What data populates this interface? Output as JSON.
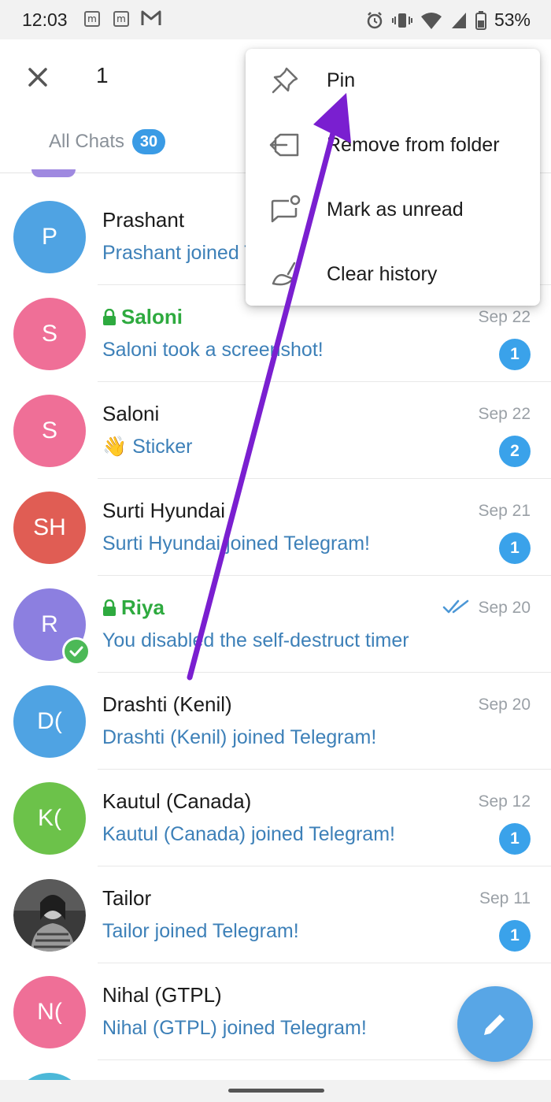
{
  "status_bar": {
    "time": "12:03",
    "notification_icons": [
      "m",
      "m"
    ],
    "battery_percent": "53%"
  },
  "action_bar": {
    "selected_count": "1",
    "tab": {
      "label": "All Chats",
      "badge": "30"
    }
  },
  "context_menu": {
    "items": [
      {
        "label": "Pin",
        "icon": "pin-icon"
      },
      {
        "label": "Remove from folder",
        "icon": "folder-remove-icon"
      },
      {
        "label": "Mark as unread",
        "icon": "mark-unread-icon"
      },
      {
        "label": "Clear history",
        "icon": "clear-history-icon"
      }
    ]
  },
  "chats": [
    {
      "initials": "P",
      "name": "Prashant",
      "message": "Prashant joined Telegram!",
      "date": "",
      "unread": "",
      "secret": false,
      "color": "#4fa3e3"
    },
    {
      "initials": "S",
      "name": "Saloni",
      "message": "Saloni took a screenshot!",
      "date": "Sep 22",
      "unread": "1",
      "secret": true,
      "color": "#ef6f97"
    },
    {
      "initials": "S",
      "name": "Saloni",
      "message": "👋 Sticker",
      "date": "Sep 22",
      "unread": "2",
      "secret": false,
      "color": "#ef6f97"
    },
    {
      "initials": "SH",
      "name": "Surti Hyundai",
      "message": "Surti Hyundai joined Telegram!",
      "date": "Sep 21",
      "unread": "1",
      "secret": false,
      "color": "#e05d54"
    },
    {
      "initials": "R",
      "name": "Riya",
      "message": "You disabled the self-destruct timer",
      "date": "Sep 20",
      "unread": "",
      "secret": true,
      "color": "#8c7fe0",
      "read_ticks": true,
      "online_check": true
    },
    {
      "initials": "D(",
      "name": "Drashti (Kenil)",
      "message": "Drashti (Kenil) joined Telegram!",
      "date": "Sep 20",
      "unread": "",
      "secret": false,
      "color": "#4fa3e3"
    },
    {
      "initials": "K(",
      "name": "Kautul (Canada)",
      "message": "Kautul (Canada) joined Telegram!",
      "date": "Sep 12",
      "unread": "1",
      "secret": false,
      "color": "#6cc24a"
    },
    {
      "initials": "",
      "name": "Tailor",
      "message": "Tailor joined Telegram!",
      "date": "Sep 11",
      "unread": "1",
      "secret": false,
      "color": "#3a3a3a",
      "photo": true
    },
    {
      "initials": "N(",
      "name": "Nihal (GTPL)",
      "message": "Nihal (GTPL) joined Telegram!",
      "date": "",
      "unread": "",
      "secret": false,
      "color": "#ef6f97"
    }
  ],
  "colors": {
    "accent": "#3a9be5",
    "link_text": "#3d80b8",
    "secret_green": "#2eaa3f",
    "annotation_arrow": "#7a1fd0"
  }
}
